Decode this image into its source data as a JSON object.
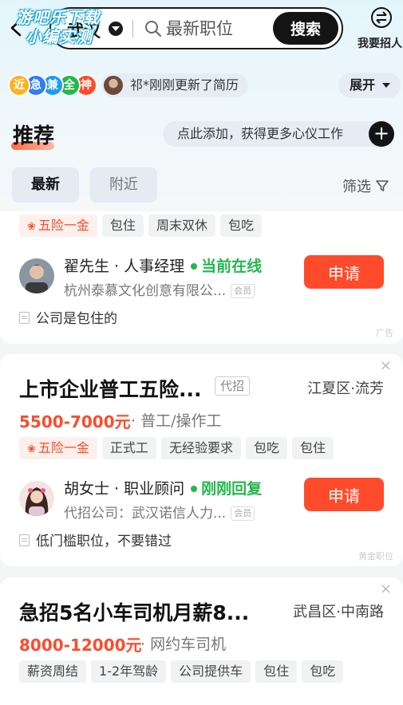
{
  "header": {
    "watermark_line1": "游吧乐下载",
    "watermark_line2": "小编实测",
    "city": "武汉",
    "search_placeholder": "最新职位",
    "search_button": "搜索",
    "recruit_label": "我要招人"
  },
  "activity": {
    "badges": [
      {
        "text": "近",
        "color": "#ffb21f"
      },
      {
        "text": "急",
        "color": "#2f7cf6"
      },
      {
        "text": "兼",
        "color": "#1e9bf0"
      },
      {
        "text": "全",
        "color": "#22b84c"
      },
      {
        "text": "神",
        "color": "#ff4b2b"
      }
    ],
    "update_text": "祁*刚刚更新了简历",
    "expand_label": "展开"
  },
  "recommend": {
    "title": "推荐",
    "add_text": "点此添加，获得更多心仪工作",
    "add_icon": "+",
    "tabs": [
      "最新",
      "附近"
    ],
    "filter_label": "筛选"
  },
  "cards": [
    {
      "tags": [
        "五险一金",
        "包住",
        "周末双休",
        "包吃"
      ],
      "recruiter_name": "翟先生 · 人事经理",
      "status": "当前在线",
      "company": "杭州泰慕文化创意有限公...",
      "member_badge": "会员",
      "apply": "申请",
      "note": "公司是包住的",
      "corner": "广告"
    },
    {
      "title": "上市企业普工五险...",
      "agency": "代招",
      "location": "江夏区·流芳",
      "salary": "5500-7000元",
      "category": "· 普工/操作工",
      "tags": [
        "五险一金",
        "正式工",
        "无经验要求",
        "包吃",
        "包住"
      ],
      "recruiter_name": "胡女士 · 职业顾问",
      "status": "刚刚回复",
      "company": "代招公司：武汉诺信人力...",
      "member_badge": "会员",
      "apply": "申请",
      "note": "低门槛职位，不要错过",
      "corner": "黄金职位",
      "close": "×"
    },
    {
      "title": "急招5名小车司机月薪8...",
      "location": "武昌区·中南路",
      "salary": "8000-12000元",
      "category": "· 网约车司机",
      "tags": [
        "薪资周结",
        "1-2年驾龄",
        "公司提供车",
        "包住",
        "包吃"
      ],
      "close": "×"
    }
  ]
}
